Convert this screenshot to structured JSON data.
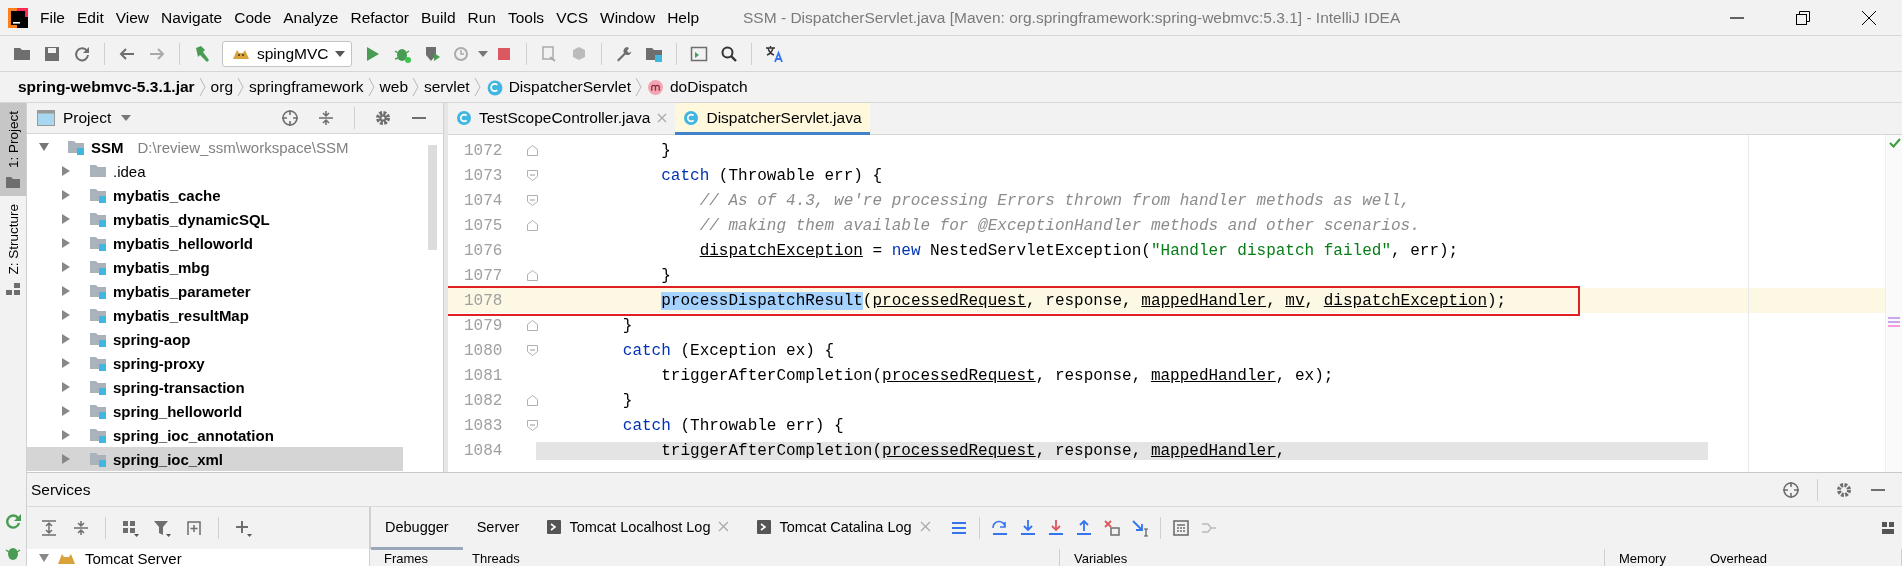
{
  "window": {
    "title": "SSM - DispatcherServlet.java [Maven: org.springframework:spring-webmvc:5.3.1] - IntelliJ IDEA"
  },
  "menu": [
    "File",
    "Edit",
    "View",
    "Navigate",
    "Code",
    "Analyze",
    "Refactor",
    "Build",
    "Run",
    "Tools",
    "VCS",
    "Window",
    "Help"
  ],
  "toolbar": {
    "run_config": "spingMVC"
  },
  "breadcrumb": [
    {
      "kind": "jar",
      "label": "spring-webmvc-5.3.1.jar"
    },
    {
      "kind": "package",
      "label": "org"
    },
    {
      "kind": "package",
      "label": "springframework"
    },
    {
      "kind": "package",
      "label": "web"
    },
    {
      "kind": "package",
      "label": "servlet"
    },
    {
      "kind": "class",
      "label": "DispatcherServlet"
    },
    {
      "kind": "method",
      "label": "doDispatch"
    }
  ],
  "tool_stripe": [
    {
      "label": "1: Project",
      "selected": true
    },
    {
      "label": "Z: Structure",
      "selected": false
    }
  ],
  "project": {
    "title": "Project",
    "tree": [
      {
        "label": "SSM",
        "path": "D:\\review_ssm\\workspace\\SSM",
        "kind": "module",
        "expanded": true,
        "selected": false,
        "children": [
          {
            "label": ".idea",
            "kind": "folder",
            "expanded": false,
            "selected": false
          },
          {
            "label": "mybatis_cache",
            "kind": "module",
            "expanded": false,
            "selected": false
          },
          {
            "label": "mybatis_dynamicSQL",
            "kind": "module",
            "expanded": false,
            "selected": false
          },
          {
            "label": "mybatis_helloworld",
            "kind": "module",
            "expanded": false,
            "selected": false
          },
          {
            "label": "mybatis_mbg",
            "kind": "module",
            "expanded": false,
            "selected": false
          },
          {
            "label": "mybatis_parameter",
            "kind": "module",
            "expanded": false,
            "selected": false
          },
          {
            "label": "mybatis_resultMap",
            "kind": "module",
            "expanded": false,
            "selected": false
          },
          {
            "label": "spring-aop",
            "kind": "module",
            "expanded": false,
            "selected": false
          },
          {
            "label": "spring-proxy",
            "kind": "module",
            "expanded": false,
            "selected": false
          },
          {
            "label": "spring-transaction",
            "kind": "module",
            "expanded": false,
            "selected": false
          },
          {
            "label": "spring_helloworld",
            "kind": "module",
            "expanded": false,
            "selected": false
          },
          {
            "label": "spring_ioc_annotation",
            "kind": "module",
            "expanded": false,
            "selected": false
          },
          {
            "label": "spring_ioc_xml",
            "kind": "module",
            "expanded": false,
            "selected": true
          }
        ]
      }
    ]
  },
  "editor": {
    "tabs": [
      {
        "label": "TestScopeController.java",
        "selected": false
      },
      {
        "label": "DispatcherServlet.java",
        "selected": true
      }
    ],
    "lines": [
      {
        "number": "1072",
        "fold_start": false,
        "fold_end": true,
        "current": false,
        "marked": false,
        "shaded": false,
        "tokens": [
          {
            "kind": "plain",
            "text": "            }"
          }
        ]
      },
      {
        "number": "1073",
        "fold_start": true,
        "fold_end": false,
        "current": false,
        "marked": false,
        "shaded": false,
        "tokens": [
          {
            "kind": "keyword",
            "text": "            catch"
          },
          {
            "kind": "plain",
            "text": " (Throwable err) {"
          }
        ]
      },
      {
        "number": "1074",
        "fold_start": true,
        "fold_end": false,
        "current": false,
        "marked": false,
        "shaded": false,
        "tokens": [
          {
            "kind": "comment",
            "text": "                // As of 4.3, we're processing Errors thrown from handler methods as well,"
          }
        ]
      },
      {
        "number": "1075",
        "fold_start": false,
        "fold_end": true,
        "current": false,
        "marked": false,
        "shaded": false,
        "tokens": [
          {
            "kind": "comment",
            "text": "                // making them available for @ExceptionHandler methods and other scenarios."
          }
        ]
      },
      {
        "number": "1076",
        "fold_start": false,
        "fold_end": false,
        "current": false,
        "marked": false,
        "shaded": false,
        "tokens": [
          {
            "kind": "field",
            "text": "                dispatchException"
          },
          {
            "kind": "plain",
            "text": " = "
          },
          {
            "kind": "keyword",
            "text": "new"
          },
          {
            "kind": "plain",
            "text": " NestedServletException("
          },
          {
            "kind": "string",
            "text": "\"Handler dispatch failed\""
          },
          {
            "kind": "plain",
            "text": ", err);"
          }
        ]
      },
      {
        "number": "1077",
        "fold_start": false,
        "fold_end": true,
        "current": false,
        "marked": false,
        "shaded": false,
        "tokens": [
          {
            "kind": "plain",
            "text": "            }"
          }
        ]
      },
      {
        "number": "1078",
        "fold_start": false,
        "fold_end": false,
        "current": true,
        "marked": true,
        "shaded": false,
        "tokens": [
          {
            "kind": "selection",
            "text": "            processDispatchResult"
          },
          {
            "kind": "plain",
            "text": "("
          },
          {
            "kind": "field",
            "text": "processedRequest"
          },
          {
            "kind": "plain",
            "text": ", response, "
          },
          {
            "kind": "field",
            "text": "mappedHandler"
          },
          {
            "kind": "plain",
            "text": ", "
          },
          {
            "kind": "field",
            "text": "mv"
          },
          {
            "kind": "plain",
            "text": ", "
          },
          {
            "kind": "field",
            "text": "dispatchException"
          },
          {
            "kind": "plain",
            "text": ");"
          }
        ]
      },
      {
        "number": "1079",
        "fold_start": false,
        "fold_end": true,
        "current": false,
        "marked": false,
        "shaded": false,
        "tokens": [
          {
            "kind": "plain",
            "text": "        }"
          }
        ]
      },
      {
        "number": "1080",
        "fold_start": true,
        "fold_end": false,
        "current": false,
        "marked": false,
        "shaded": false,
        "tokens": [
          {
            "kind": "keyword",
            "text": "        catch"
          },
          {
            "kind": "plain",
            "text": " (Exception ex) {"
          }
        ]
      },
      {
        "number": "1081",
        "fold_start": false,
        "fold_end": false,
        "current": false,
        "marked": false,
        "shaded": false,
        "tokens": [
          {
            "kind": "plain",
            "text": "            triggerAfterCompletion("
          },
          {
            "kind": "field",
            "text": "processedRequest"
          },
          {
            "kind": "plain",
            "text": ", response, "
          },
          {
            "kind": "field",
            "text": "mappedHandler"
          },
          {
            "kind": "plain",
            "text": ", ex);"
          }
        ]
      },
      {
        "number": "1082",
        "fold_start": false,
        "fold_end": true,
        "current": false,
        "marked": false,
        "shaded": false,
        "tokens": [
          {
            "kind": "plain",
            "text": "        }"
          }
        ]
      },
      {
        "number": "1083",
        "fold_start": true,
        "fold_end": false,
        "current": false,
        "marked": false,
        "shaded": false,
        "tokens": [
          {
            "kind": "keyword",
            "text": "        catch"
          },
          {
            "kind": "plain",
            "text": " (Throwable err) {"
          }
        ]
      },
      {
        "number": "1084",
        "fold_start": false,
        "fold_end": false,
        "current": false,
        "marked": false,
        "shaded": true,
        "tokens": [
          {
            "kind": "plain",
            "text": "            triggerAfterCompletion("
          },
          {
            "kind": "field",
            "text": "processedRequest"
          },
          {
            "kind": "plain",
            "text": ", response, "
          },
          {
            "kind": "field",
            "text": "mappedHandler"
          },
          {
            "kind": "plain",
            "text": ","
          }
        ]
      }
    ]
  },
  "services": {
    "title": "Services",
    "tree": [
      {
        "label": "Tomcat Server",
        "expanded": true
      }
    ],
    "tabs": [
      {
        "label": "Debugger",
        "kind": "plain",
        "selected": true,
        "closable": false
      },
      {
        "label": "Server",
        "kind": "plain",
        "selected": false,
        "closable": false
      },
      {
        "label": "Tomcat Localhost Log",
        "kind": "log",
        "selected": false,
        "closable": true
      },
      {
        "label": "Tomcat Catalina Log",
        "kind": "log",
        "selected": false,
        "closable": true
      }
    ],
    "panes": [
      {
        "tabs": [
          "Frames",
          "Threads"
        ]
      },
      {
        "tabs": [
          "Variables"
        ]
      },
      {
        "tabs": [
          "Memory",
          "Overhead"
        ]
      }
    ]
  }
}
